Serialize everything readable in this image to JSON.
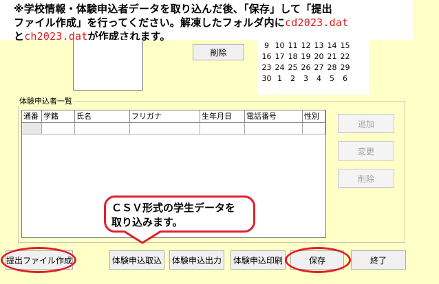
{
  "note": {
    "line1": "※学校情報・体験申込者データを取り込んだ後、「保存」して「提出",
    "line2_prefix": "ファイル作成」を行ってください。解凍したフォルダ内に",
    "file1": "cd2023.dat",
    "line3_prefix": "と",
    "file2": "ch2023.dat",
    "line3_suffix": "が作成されます。"
  },
  "top": {
    "delete_label": "削除"
  },
  "calendar": {
    "rows": [
      [
        "9",
        "10",
        "11",
        "12",
        "13",
        "14",
        "15"
      ],
      [
        "16",
        "17",
        "18",
        "19",
        "20",
        "21",
        "22"
      ],
      [
        "23",
        "24",
        "25",
        "26",
        "27",
        "28",
        "29"
      ],
      [
        "30",
        "1",
        "2",
        "3",
        "4",
        "5",
        "6"
      ]
    ]
  },
  "group": {
    "title": "体験申込者一覧"
  },
  "grid": {
    "columns": [
      "通番",
      "学籍",
      "氏名",
      "フリガナ",
      "生年月日",
      "電話番号",
      "性別"
    ]
  },
  "side": {
    "add": "追加",
    "edit": "変更",
    "delete": "削除"
  },
  "callout": {
    "line1": "ＣＳＶ形式の学生データを",
    "line2": "取り込みます。"
  },
  "buttons": {
    "make_file": "提出ファイル作成",
    "import": "体験申込取込",
    "export": "体験申込出力",
    "print": "体験申込印刷",
    "save": "保存",
    "exit": "終了"
  },
  "colors": {
    "highlight": "#e0202c",
    "background": "#ffffc8"
  }
}
